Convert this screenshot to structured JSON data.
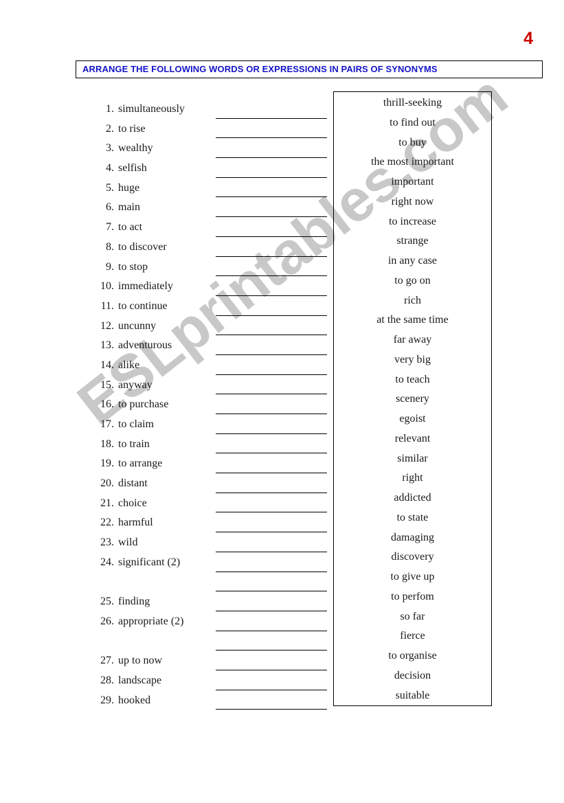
{
  "page": {
    "page_number": "4",
    "page_number_color": "#cc0000",
    "background_color": "#ffffff"
  },
  "watermark": {
    "text": "ESLprintables.com",
    "color": "#c8c8c8"
  },
  "title_bar": {
    "text": "ARRANGE THE FOLLOWING WORDS OR EXPRESSIONS IN PAIRS OF SYNONYMS",
    "text_color": "#1414c8",
    "border_color": "#000000"
  },
  "word_list": {
    "items": [
      {
        "number": "1.",
        "label": "simultaneously"
      },
      {
        "number": "2.",
        "label": "to rise"
      },
      {
        "number": "3.",
        "label": "wealthy"
      },
      {
        "number": "4.",
        "label": "selfish"
      },
      {
        "number": "5.",
        "label": "huge"
      },
      {
        "number": "6.",
        "label": "main"
      },
      {
        "number": "7.",
        "label": "to act"
      },
      {
        "number": "8.",
        "label": "to discover"
      },
      {
        "number": "9.",
        "label": "to stop"
      },
      {
        "number": "10.",
        "label": "immediately"
      },
      {
        "number": "11.",
        "label": "to continue"
      },
      {
        "number": "12.",
        "label": "uncunny"
      },
      {
        "number": "13.",
        "label": "adventurous"
      },
      {
        "number": "14.",
        "label": "alike"
      },
      {
        "number": "15.",
        "label": "anyway"
      },
      {
        "number": "16.",
        "label": "to purchase"
      },
      {
        "number": "17.",
        "label": "to claim"
      },
      {
        "number": "18.",
        "label": "to train"
      },
      {
        "number": "19.",
        "label": "to arrange"
      },
      {
        "number": "20.",
        "label": "distant"
      },
      {
        "number": "21.",
        "label": "choice"
      },
      {
        "number": "22.",
        "label": "harmful"
      },
      {
        "number": "23.",
        "label": "wild"
      },
      {
        "number": "24.",
        "label": "significant (2)"
      },
      {
        "number": "",
        "label": ""
      },
      {
        "number": "25.",
        "label": "finding"
      },
      {
        "number": "26.",
        "label": "appropriate (2)"
      },
      {
        "number": "",
        "label": ""
      },
      {
        "number": "27.",
        "label": "up to now"
      },
      {
        "number": "28.",
        "label": "landscape"
      },
      {
        "number": "29.",
        "label": "hooked"
      }
    ]
  },
  "answer_lines": {
    "count": 31
  },
  "word_bank": {
    "items": [
      "thrill-seeking",
      "to find out",
      "to buy",
      "the most important",
      "important",
      "right now",
      "to increase",
      "strange",
      "in any case",
      "to go on",
      "rich",
      "at the same time",
      "far away",
      "very big",
      "to teach",
      "scenery",
      "egoist",
      "relevant",
      "similar",
      "right",
      "addicted",
      "to state",
      "damaging",
      "discovery",
      "to give up",
      "to perfom",
      "so far",
      "fierce",
      "to organise",
      "decision",
      "suitable"
    ]
  }
}
